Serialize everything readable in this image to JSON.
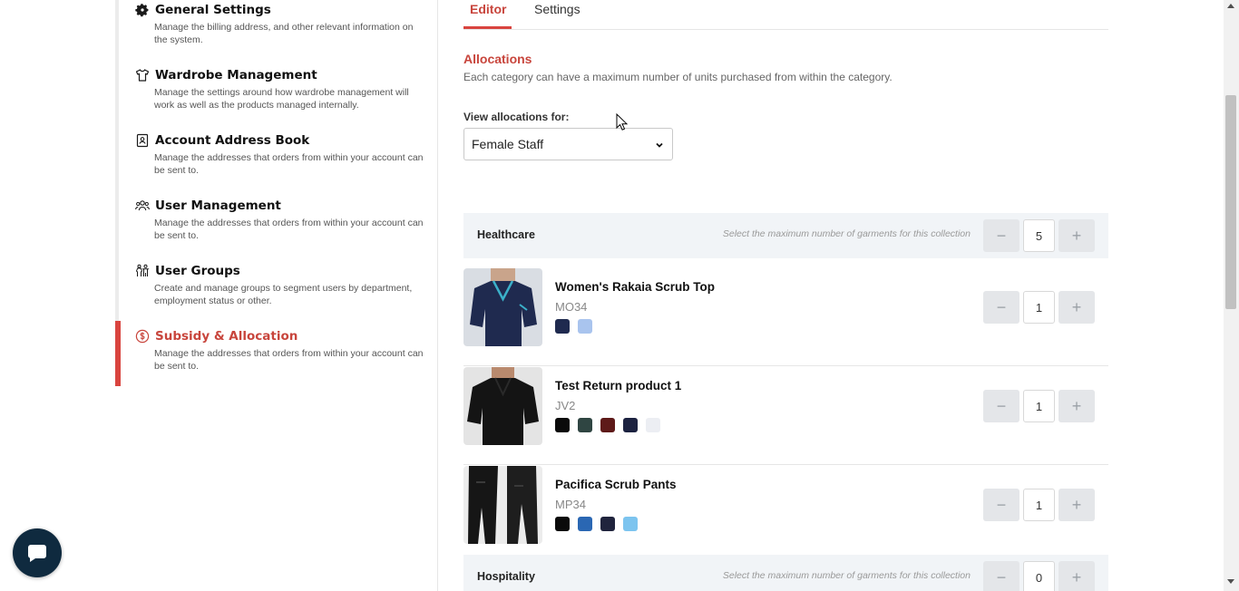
{
  "sidebar": {
    "items": [
      {
        "title": "General Settings",
        "desc": "Manage the billing address, and other relevant information on the system.",
        "icon": "gear-icon"
      },
      {
        "title": "Wardrobe Management",
        "desc": "Manage the settings around how wardrobe management will work as well as the products managed internally.",
        "icon": "shirt-icon"
      },
      {
        "title": "Account Address Book",
        "desc": "Manage the addresses that orders from within your account can be sent to.",
        "icon": "address-book-icon"
      },
      {
        "title": "User Management",
        "desc": "Manage the addresses that orders from within your account can be sent to.",
        "icon": "users-icon"
      },
      {
        "title": "User Groups",
        "desc": "Create and manage groups to segment users by department, employment status or other.",
        "icon": "user-groups-icon"
      },
      {
        "title": "Subsidy & Allocation",
        "desc": "Manage the addresses that orders from within your account can be sent to.",
        "icon": "dollar-circle-icon",
        "active": true
      }
    ]
  },
  "tabs": {
    "editor": "Editor",
    "settings": "Settings",
    "active": "Editor"
  },
  "allocations": {
    "title": "Allocations",
    "desc": "Each category can have a maximum number of units purchased from within the category.",
    "view_label": "View allocations for:",
    "selected_group": "Female Staff"
  },
  "collections": [
    {
      "name": "Healthcare",
      "hint": "Select the maximum number of garments for this collection",
      "max": "5"
    },
    {
      "name": "Hospitality",
      "hint": "Select the maximum number of garments for this collection",
      "max": "0"
    }
  ],
  "products": [
    {
      "name": "Women's Rakaia Scrub Top",
      "sku": "MO34",
      "qty": "1",
      "swatches": [
        "#1f2a4f",
        "#a9c4ee"
      ]
    },
    {
      "name": "Test Return product 1",
      "sku": "JV2",
      "qty": "1",
      "swatches": [
        "#0a0a0a",
        "#2f4542",
        "#5e1a19",
        "#1c2240",
        "#eceef3"
      ]
    },
    {
      "name": "Pacifica Scrub Pants",
      "sku": "MP34",
      "qty": "1",
      "swatches": [
        "#0a0a0a",
        "#2a67b3",
        "#20243d",
        "#7cc4ef"
      ]
    }
  ],
  "stepper": {
    "minus": "−",
    "plus": "+"
  },
  "colors": {
    "accent": "#c8453c",
    "accent_bar": "#d9443f",
    "header_bg": "#f1f4f7",
    "chat_bg": "#0f2a3f"
  }
}
